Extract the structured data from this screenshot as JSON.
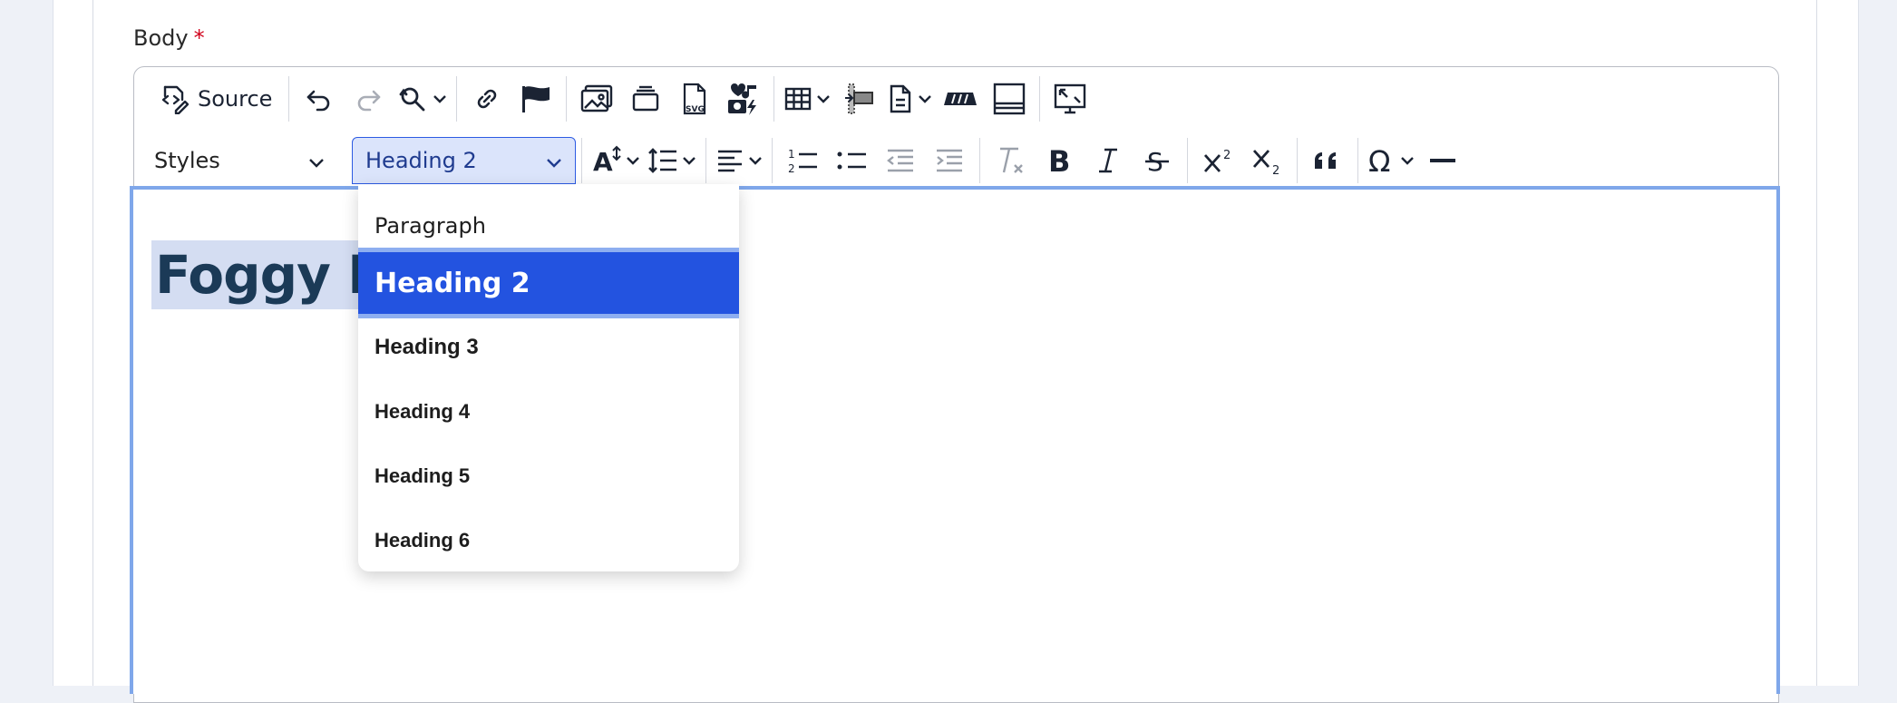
{
  "field": {
    "label": "Body",
    "required_mark": "*"
  },
  "toolbar": {
    "source_label": "Source",
    "icons": [
      "source-icon",
      "undo-icon",
      "redo-icon",
      "find-replace-icon",
      "link-icon",
      "flag-icon",
      "image-icon",
      "media-embed-icon",
      "svg-icon",
      "media-icon",
      "table-icon",
      "indent-block-icon",
      "document-icon",
      "code-block-icon",
      "horizontal-split-icon",
      "screen-icon",
      "font-size-icon",
      "line-height-icon",
      "align-icon",
      "numbered-list-icon",
      "bulleted-list-icon",
      "outdent-icon",
      "indent-icon",
      "remove-format-icon",
      "bold-icon",
      "italic-icon",
      "strikethrough-icon",
      "superscript-icon",
      "subscript-icon",
      "blockquote-icon",
      "special-chars-icon",
      "horizontal-line-icon"
    ],
    "styles_label": "Styles",
    "heading_selected": "Heading 2"
  },
  "editor": {
    "heading_text": "Foggy Bo"
  },
  "heading_dropdown": {
    "items": [
      "Paragraph",
      "Heading 2",
      "Heading 3",
      "Heading 4",
      "Heading 5",
      "Heading 6"
    ],
    "selected_index": 1
  },
  "colors": {
    "accent": "#2353e0",
    "focus_border": "#7fa7ea",
    "heading_text": "#1b3a57",
    "required": "#d0021b"
  }
}
